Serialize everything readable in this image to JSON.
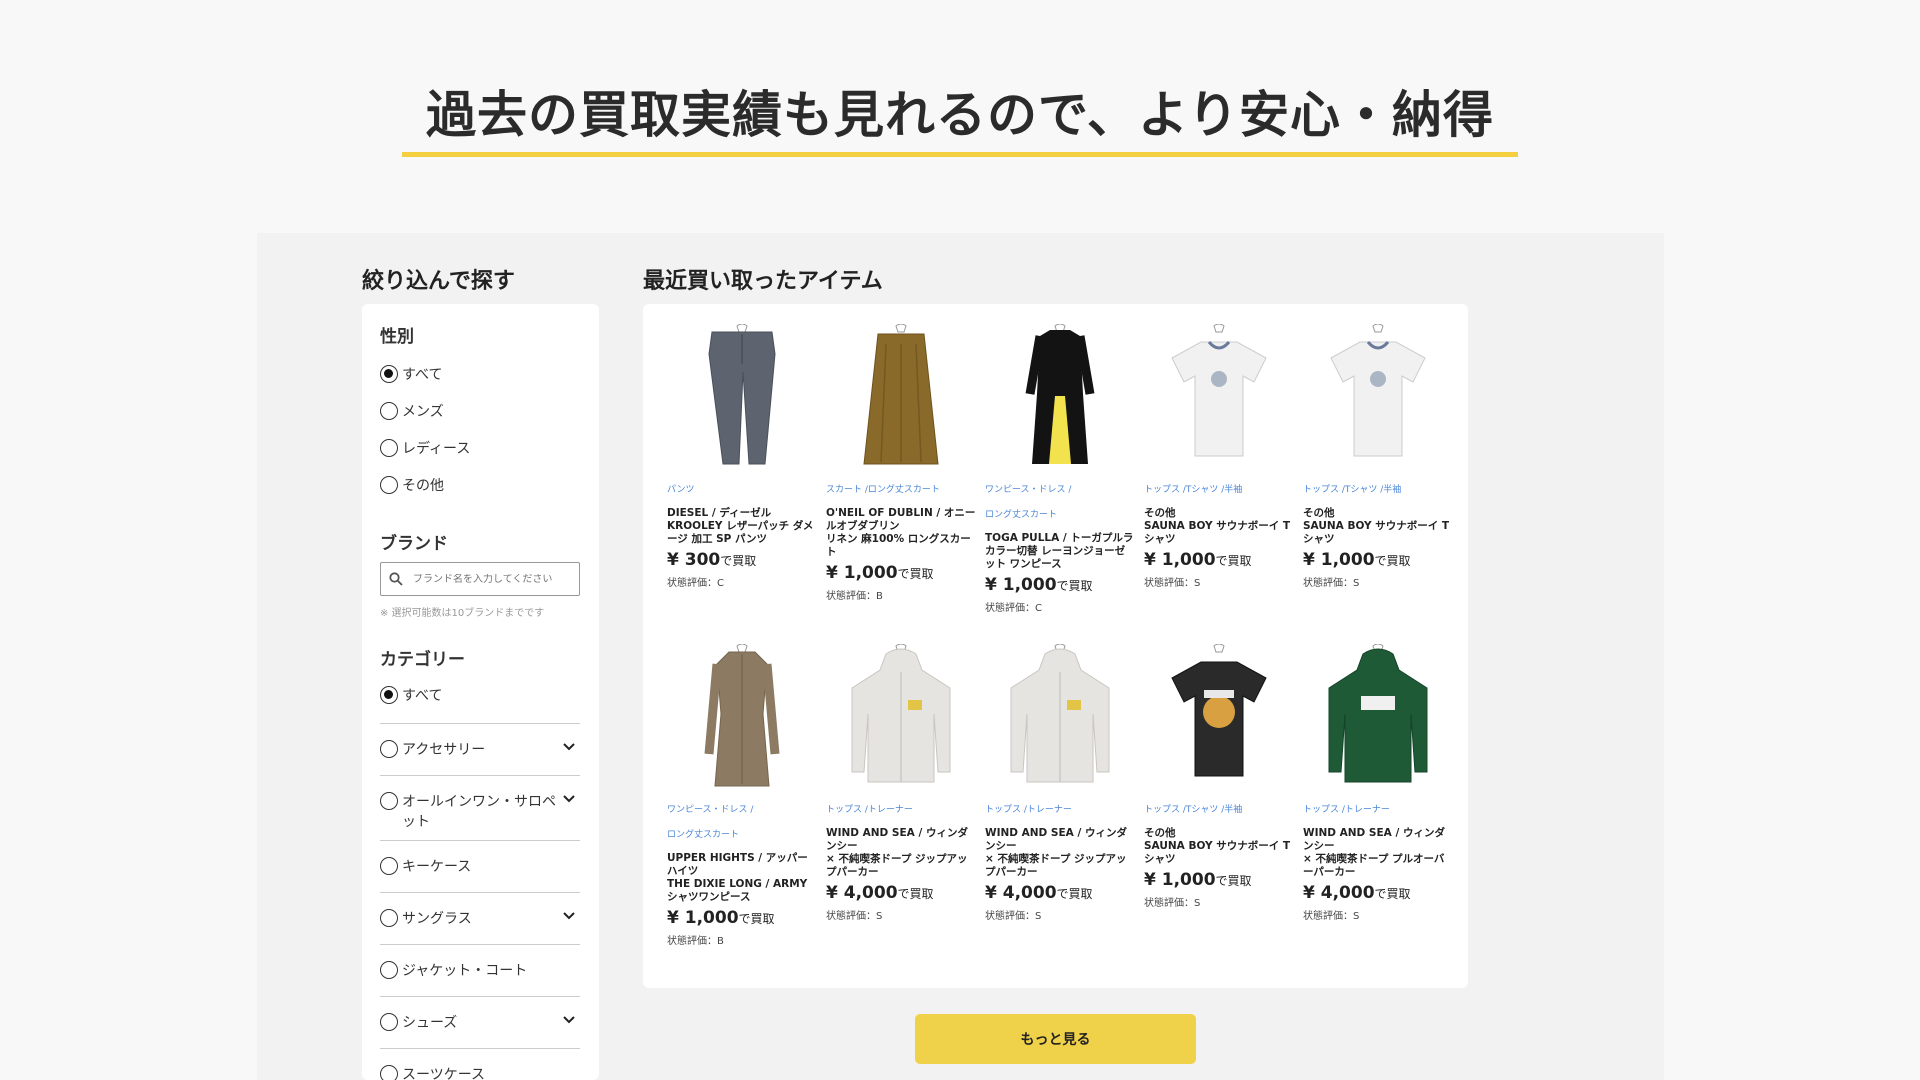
{
  "headline": "過去の買取実績も見れるので、より安心・納得",
  "sidebar": {
    "title": "絞り込んで探す",
    "gender": {
      "heading": "性別",
      "options": [
        "すべて",
        "メンズ",
        "レディース",
        "その他"
      ],
      "selected": "すべて"
    },
    "brand": {
      "heading": "ブランド",
      "placeholder": "ブランド名を入力してください",
      "note": "※ 選択可能数は10ブランドまでです"
    },
    "category": {
      "heading": "カテゴリー",
      "options": [
        {
          "label": "すべて",
          "expandable": false
        },
        {
          "label": "アクセサリー",
          "expandable": true
        },
        {
          "label": "オールインワン・サロペット",
          "expandable": true
        },
        {
          "label": "キーケース",
          "expandable": false
        },
        {
          "label": "サングラス",
          "expandable": true
        },
        {
          "label": "ジャケット・コート",
          "expandable": false
        },
        {
          "label": "シューズ",
          "expandable": true
        },
        {
          "label": "スーツケース",
          "expandable": false
        }
      ]
    }
  },
  "main": {
    "title": "最近買い取ったアイテム",
    "items": [
      {
        "category": "パンツ",
        "name": "DIESEL / ディーゼル\nKROOLEY レザーパッチ ダメージ 加工 SP パンツ",
        "price": "¥ 300",
        "price_suffix": "で買取",
        "condition": "状態評価：C",
        "image": "jeans"
      },
      {
        "category": "スカート /ロング丈スカート",
        "name": "O'NEIL OF DUBLIN / オニールオブダブリン\nリネン 麻100% ロングスカート",
        "price": "¥ 1,000",
        "price_suffix": "で買取",
        "condition": "状態評価：B",
        "image": "skirt"
      },
      {
        "category": "ワンピース・ドレス /\nロング丈スカート",
        "name": "TOGA PULLA / トーガプルラ\nカラー切替 レーヨンジョーゼット ワンピース",
        "price": "¥ 1,000",
        "price_suffix": "で買取",
        "condition": "状態評価：C",
        "image": "dress"
      },
      {
        "category": "トップス /Tシャツ /半袖",
        "name": "その他\nSAUNA BOY サウナボーイ Tシャツ",
        "price": "¥ 1,000",
        "price_suffix": "で買取",
        "condition": "状態評価：S",
        "image": "tee-white"
      },
      {
        "category": "トップス /Tシャツ /半袖",
        "name": "その他\nSAUNA BOY サウナボーイ Tシャツ",
        "price": "¥ 1,000",
        "price_suffix": "で買取",
        "condition": "状態評価：S",
        "image": "tee-white"
      },
      {
        "category": "ワンピース・ドレス /\nロング丈スカート",
        "name": "UPPER HIGHTS / アッパーハイツ\nTHE DIXIE LONG / ARMY シャツワンピース",
        "price": "¥ 1,000",
        "price_suffix": "で買取",
        "condition": "状態評価：B",
        "image": "shirtdress"
      },
      {
        "category": "トップス /トレーナー",
        "name": "WIND AND SEA / ウィンダンシー\n× 不純喫茶ドープ ジップアップパーカー",
        "price": "¥ 4,000",
        "price_suffix": "で買取",
        "condition": "状態評価：S",
        "image": "hoodie-grey"
      },
      {
        "category": "トップス /トレーナー",
        "name": "WIND AND SEA / ウィンダンシー\n× 不純喫茶ドープ ジップアップパーカー",
        "price": "¥ 4,000",
        "price_suffix": "で買取",
        "condition": "状態評価：S",
        "image": "hoodie-grey"
      },
      {
        "category": "トップス /Tシャツ /半袖",
        "name": "その他\nSAUNA BOY サウナボーイ Tシャツ",
        "price": "¥ 1,000",
        "price_suffix": "で買取",
        "condition": "状態評価：S",
        "image": "tee-black"
      },
      {
        "category": "トップス /トレーナー",
        "name": "WIND AND SEA / ウィンダンシー\n× 不純喫茶ドープ プルオーバーパーカー",
        "price": "¥ 4,000",
        "price_suffix": "で買取",
        "condition": "状態評価：S",
        "image": "hoodie-green"
      }
    ]
  },
  "more_button": "もっと見る",
  "colors": {
    "accent_yellow": "#f0d24a",
    "category_blue": "#4a86d8",
    "panel_bg": "#f2f2f3"
  }
}
